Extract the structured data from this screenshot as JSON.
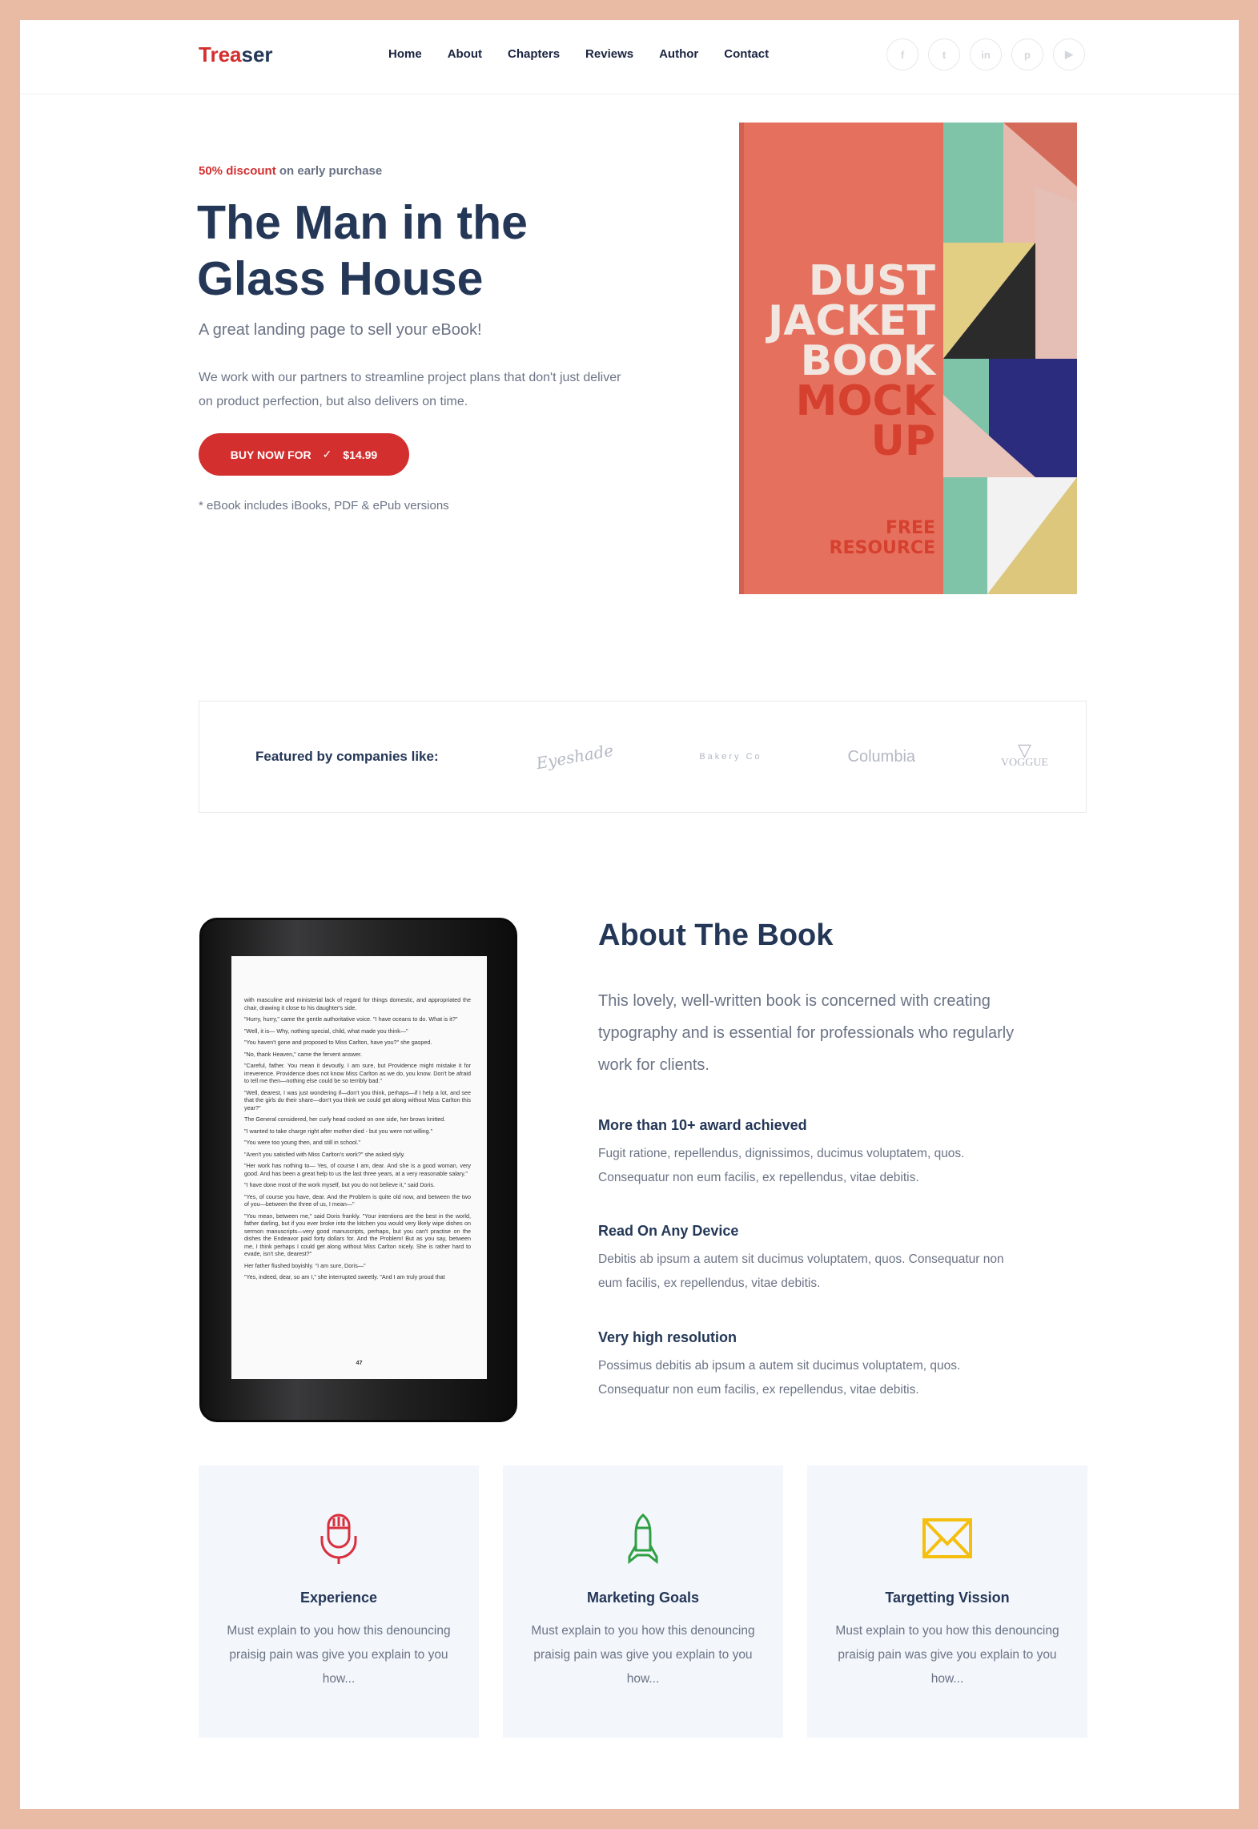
{
  "header": {
    "logo_red": "Trea",
    "logo_dark": "ser",
    "nav": [
      "Home",
      "About",
      "Chapters",
      "Reviews",
      "Author",
      "Contact"
    ],
    "social": [
      {
        "icon": "facebook-icon",
        "glyph": "f"
      },
      {
        "icon": "twitter-icon",
        "glyph": "t"
      },
      {
        "icon": "linkedin-icon",
        "glyph": "in"
      },
      {
        "icon": "pinterest-icon",
        "glyph": "p"
      },
      {
        "icon": "youtube-icon",
        "glyph": "▶"
      }
    ]
  },
  "hero": {
    "discount_highlight": "50% discount",
    "discount_rest": " on early purchase",
    "title": "The Man in the Glass House",
    "subtitle": "A great landing page to sell your eBook!",
    "paragraph": "We work with our partners to streamline project plans that don't just deliver on product perfection, but also delivers on time.",
    "buy_label": "BUY NOW FOR",
    "buy_check": "✓",
    "buy_price": "$14.99",
    "note": "* eBook includes iBooks, PDF & ePub versions",
    "cover": {
      "line1": "DUST",
      "line2": "JACKET",
      "line3": "BOOK",
      "line4": "MOCK",
      "line5": "UP",
      "free1": "FREE",
      "free2": "RESOURCE"
    }
  },
  "featured": {
    "label": "Featured by companies like:",
    "logos": [
      "Eyeshade",
      "Bakery Co",
      "Columbia",
      "VOGGUE"
    ]
  },
  "tablet": {
    "lines": [
      "with masculine and ministerial lack of regard for things domestic, and appropriated the chair, drawing it close to his daughter's side.",
      "\"Hurry, hurry,\" came the gentle authoritative voice. \"I have oceans to do. What is it?\"",
      "\"Well, it is— Why, nothing special, child, what made you think—\"",
      "\"You haven't gone and proposed to Miss Carlton, have you?\" she gasped.",
      "\"No, thank Heaven,\" came the fervent answer.",
      "\"Careful, father. You mean it devoutly, I am sure, but Providence might mistake it for irreverence. Providence does not know Miss Carlton as we do, you know. Don't be afraid to tell me then—nothing else could be so terribly bad.\"",
      "\"Well, dearest, I was just wondering if—don't you think, perhaps—if I help a lot, and see that the girls do their share—don't you think we could get along without Miss Carlton this year?\"",
      "The General considered, her curly head cocked on one side, her brows knitted.",
      "\"I wanted to take charge right after mother died - but you were not willing.\"",
      "\"You were too young then, and still in school.\"",
      "\"Aren't you satisfied with Miss Carlton's work?\" she asked slyly.",
      "\"Her work has nothing to— Yes, of course I am, dear. And she is a good woman, very good. And has been a great help to us the last three years, at a very reasonable salary.\"",
      "\"I have done most of the work myself, but you do not believe it,\" said Doris.",
      "\"Yes, of course you have, dear. And the Problem is quite old now, and between the two of you—between the three of us, I mean—\"",
      "\"You mean, between me,\" said Doris frankly. \"Your intentions are the best in the world, father darling, but if you ever broke into the kitchen you would very likely wipe dishes on sermon manuscripts—very good manuscripts, perhaps, but you can't practise on the dishes the Endeavor paid forty dollars for. And the Problem! But as you say, between me, I think perhaps I could get along without Miss Carlton nicely. She is rather hard to evade, isn't she, dearest?\"",
      "Her father flushed boyishly. \"I am sure, Doris—\"",
      "\"Yes, indeed, dear, so am I,\" she interrupted sweetly. \"And I am truly proud that"
    ],
    "page": "47"
  },
  "about": {
    "title": "About The Book",
    "paragraph": "This lovely, well-written book is concerned with creating typography and is essential for professionals who regularly work for clients.",
    "features": [
      {
        "title": "More than 10+ award achieved",
        "text": "Fugit ratione, repellendus, dignissimos, ducimus voluptatem, quos. Consequatur non eum facilis, ex repellendus, vitae debitis."
      },
      {
        "title": "Read On Any Device",
        "text": "Debitis ab ipsum a autem sit ducimus voluptatem, quos. Consequatur non eum facilis, ex repellendus, vitae debitis."
      },
      {
        "title": "Very high resolution",
        "text": "Possimus debitis ab ipsum a autem sit ducimus voluptatem, quos. Consequatur non eum facilis, ex repellendus, vitae debitis."
      }
    ]
  },
  "cards": [
    {
      "icon": "microphone-icon",
      "color": "#d9303f",
      "title": "Experience",
      "text": "Must explain to you how this denouncing praisig pain was give you explain to you how..."
    },
    {
      "icon": "rocket-icon",
      "color": "#2ea043",
      "title": "Marketing Goals",
      "text": "Must explain to you how this denouncing praisig pain was give you explain to you how..."
    },
    {
      "icon": "envelope-icon",
      "color": "#f5bf0f",
      "title": "Targetting Vission",
      "text": "Must explain to you how this denouncing praisig pain was give you explain to you how..."
    }
  ]
}
